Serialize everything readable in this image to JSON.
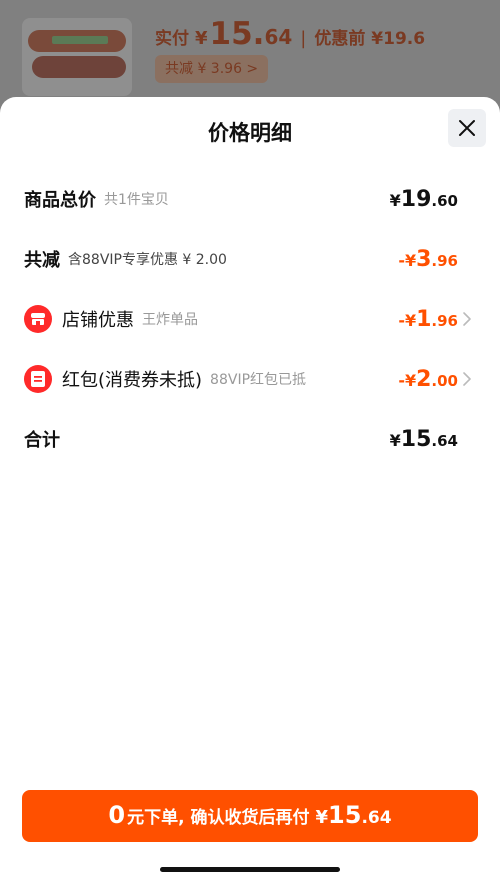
{
  "header": {
    "price_prefix": "实付",
    "currency": "¥",
    "price_int": "15.",
    "price_dec": "64",
    "separator": "|",
    "before_label": "优惠前 ¥19.6",
    "reduce_pill": "共减 ¥ 3.96 >"
  },
  "sheet": {
    "title": "价格明细",
    "rows": [
      {
        "label": "商品总价",
        "sub": "共1件宝贝",
        "amount": {
          "y": "¥",
          "i": "19",
          "d": ".60"
        }
      },
      {
        "label": "共减",
        "sub": "含88VIP专享优惠 ¥ 2.00",
        "amount": {
          "y": "-¥",
          "i": "3",
          "d": ".96"
        }
      },
      {
        "label": "店铺优惠",
        "sub": "王炸单品",
        "amount": {
          "y": "-¥",
          "i": "1",
          "d": ".96"
        }
      },
      {
        "label": "红包(消费券未抵)",
        "sub": "88VIP红包已抵",
        "amount": {
          "y": "-¥",
          "i": "2",
          "d": ".00"
        }
      },
      {
        "label": "合计",
        "amount": {
          "y": "¥",
          "i": "15",
          "d": ".64"
        }
      }
    ]
  },
  "pay_button": {
    "zero": "0",
    "text": "元下单, 确认收货后再付",
    "y": "¥",
    "i": "15",
    "d": ".64"
  },
  "colors": {
    "accent": "#ff5000",
    "red": "#ff2a2a"
  }
}
